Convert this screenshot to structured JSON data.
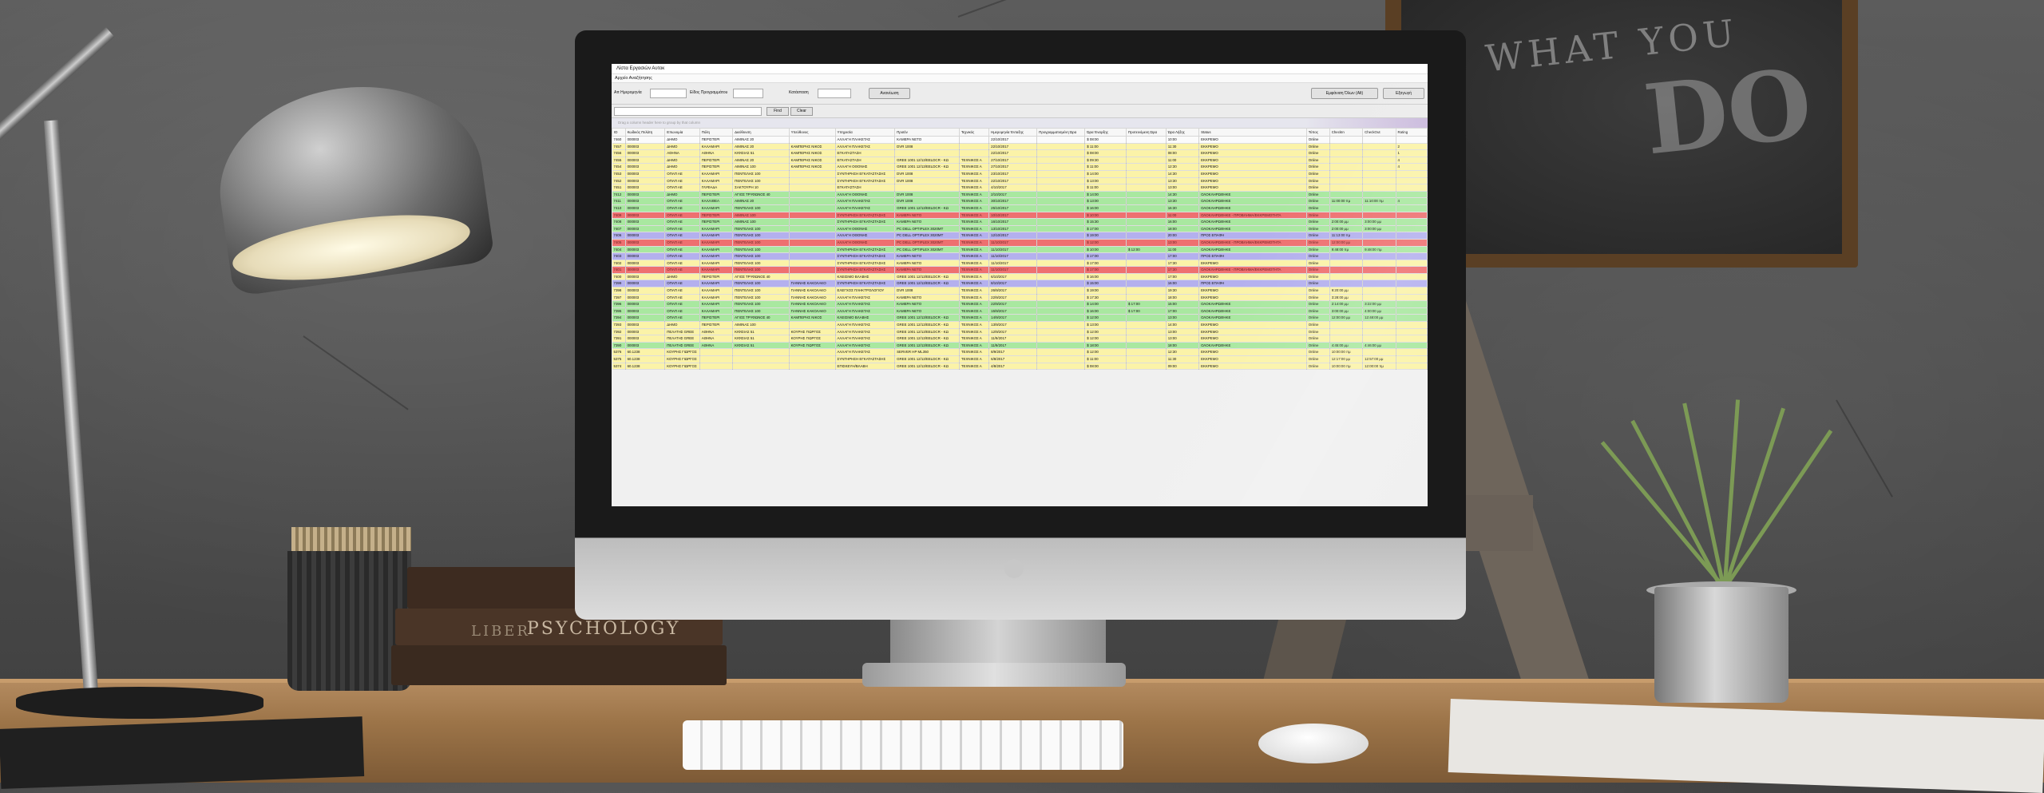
{
  "scene": {
    "chalkboard_text_top": "WHAT YOU",
    "chalkboard_text_big": "DO",
    "book_title_1": "LIBER",
    "book_title_2": "PSYCHOLOGY"
  },
  "app": {
    "window_title": "Λίστα Εργασιών Αυτοκ",
    "menu": "Αρχείο Αναζήτησης",
    "filters": {
      "date_label": "Απ Ημερομηνία",
      "date_value": "",
      "type_label": "Είδος Προγραμμάτου",
      "type_value": "",
      "status_label": "Κατάσταση",
      "status_value": "",
      "refresh_button": "Ανανέωση",
      "new_order_button": "Εμφάνιση Όλων (Alt)",
      "export_button": "Εξαγωγή"
    },
    "search": {
      "placeholder": "",
      "find_button": "Find",
      "clear_button": "Clear"
    },
    "group_hint": "Drag a column header here to group by that column",
    "columns": [
      "ID",
      "Κωδικός Πελάτη",
      "Επωνυμία",
      "Πόλη",
      "Διεύθυνση",
      "Υπεύθυνος",
      "Υπηρεσία",
      "Προϊόν",
      "Τεχνικός",
      "Ημερομηνία Ένταξης",
      "Προγραμματισμένη Ώρα",
      "Ώρα Έναρξης",
      "Προτεινόμενη Ώρα",
      "Ώρα Λήξης",
      "Status",
      "Τύπος",
      "CheckIn",
      "CheckOut",
      "Rating"
    ],
    "rows": [
      {
        "color": "white",
        "cells": [
          "7460",
          "000003",
          "ΔΗΜΟ",
          "ΠΕΡΙΣΤΕΡΙ",
          "ΑΙΜΙΝΑΣ 20",
          "",
          "ΑΛΛΑΓΗ ΠΛΑΚΕΤΑΣ",
          "ΚΑΜΕΡΑ ΝΕΤΟ",
          "",
          "22/10/2017",
          "",
          "$ 08:00",
          "",
          "10:00",
          "ΕΚΚΡΕΜΟ",
          "Online",
          "",
          "",
          ""
        ]
      },
      {
        "color": "yellow",
        "cells": [
          "7457",
          "000003",
          "ΔΗΜΟ",
          "ΚΑΛΑΜΑΡΙ",
          "ΑΙΜΙΝΑΣ 20",
          "ΚΑΜΠΕΡΗΣ ΝΙΚΟΣ",
          "ΑΛΛΑΓΗ ΠΛΑΚΕΤΑΣ",
          "DVR 1008",
          "",
          "22/10/2017",
          "",
          "$ 11:00",
          "",
          "11:30",
          "ΕΚΚΡΕΜΟ",
          "Online",
          "",
          "",
          "2"
        ]
      },
      {
        "color": "yellow",
        "cells": [
          "7456",
          "000003",
          "ΑΘΗΝΑ",
          "ΑΘΗΝΑ",
          "ΚΙΦΙΣΙΑΣ 51",
          "ΚΑΜΠΕΡΗΣ ΝΙΚΟΣ",
          "ΕΓΚΑΤΑΣΤΑΣΗ",
          "",
          "",
          "22/10/2017",
          "",
          "$ 08:00",
          "",
          "08:00",
          "ΕΚΚΡΕΜΟ",
          "Online",
          "",
          "",
          "1"
        ]
      },
      {
        "color": "yellow",
        "cells": [
          "7455",
          "000003",
          "ΔΗΜΟ",
          "ΠΕΡΙΣΤΕΡΙ",
          "ΑΙΜΙΝΑΣ 20",
          "ΚΑΜΠΕΡΗΣ ΝΙΚΟΣ",
          "ΕΓΚΑΤΑΣΤΑΣΗ",
          "GREE 1001 12/13/EELDCR - KΩ",
          "ΤΕΧΝΙΚΟΣ Α",
          "27/10/2017",
          "",
          "$ 09:30",
          "",
          "11:00",
          "ΕΚΚΡΕΜΟ",
          "Online",
          "",
          "",
          "4"
        ]
      },
      {
        "color": "yellow",
        "cells": [
          "7454",
          "000003",
          "ΔΗΜΟ",
          "ΠΕΡΙΣΤΕΡΙ",
          "ΑΙΜΙΝΑΣ 100",
          "ΚΑΜΠΕΡΗΣ ΝΙΚΟΣ",
          "ΑΛΛΑΓΗ ΟΘΟΝΗΣ",
          "GREE 1001 12/13/EELDCR - KΩ",
          "ΤΕΧΝΙΚΟΣ Α",
          "27/10/2017",
          "",
          "$ 11:00",
          "",
          "12:30",
          "ΕΚΚΡΕΜΟ",
          "Online",
          "",
          "",
          "4"
        ]
      },
      {
        "color": "yellow",
        "cells": [
          "7453",
          "000003",
          "ΟΠΑΠ ΑΕ",
          "ΚΑΛΑΜΑΡΙ",
          "ΠΕΝΤΕΛΗΣ 100",
          "",
          "ΣΥΝΤΗΡΗΣΗ ΕΓΚΑΤΑΣΤΑΣΗΣ",
          "DVR 1008",
          "ΤΕΧΝΙΚΟΣ Α",
          "23/10/2017",
          "",
          "$ 14:00",
          "",
          "14:30",
          "ΕΚΚΡΕΜΟ",
          "Online",
          "",
          "",
          ""
        ]
      },
      {
        "color": "yellow",
        "cells": [
          "7452",
          "000003",
          "ΟΠΑΠ ΑΕ",
          "ΚΑΛΑΜΑΡΙ",
          "ΠΕΝΤΕΛΗΣ 100",
          "",
          "ΣΥΝΤΗΡΗΣΗ ΕΓΚΑΤΑΣΤΑΣΗΣ",
          "DVR 1008",
          "ΤΕΧΝΙΚΟΣ Α",
          "22/10/2017",
          "",
          "$ 13:00",
          "",
          "13:30",
          "ΕΚΚΡΕΜΟ",
          "Online",
          "",
          "",
          ""
        ]
      },
      {
        "color": "yellow",
        "cells": [
          "7451",
          "000003",
          "ΟΠΑΠ ΑΕ",
          "ΓΛΥΦΑΔΑ",
          "ΣΑΚΤΟΥΡΗ 10",
          "",
          "ΕΓΚΑΤΑΣΤΑΣΗ",
          "",
          "ΤΕΧΝΙΚΟΣ Α",
          "4/10/2017",
          "",
          "$ 11:00",
          "",
          "13:00",
          "ΕΚΚΡΕΜΟ",
          "Online",
          "",
          "",
          ""
        ]
      },
      {
        "color": "green",
        "cells": [
          "7412",
          "000003",
          "ΔΗΜΟ",
          "ΠΕΡΙΣΤΕΡΙ",
          "ΑΓΙΟΣ ΤΡΥΦΩΝΟΣ 40",
          "",
          "ΑΛΛΑΓΗ ΟΘΟΝΗΣ",
          "DVR 1008",
          "ΤΕΧΝΙΚΟΣ Α",
          "2/10/2017",
          "",
          "$ 14:00",
          "",
          "14:30",
          "ΟΛΟΚΛΗΡΩΘΗΚΕ",
          "Online",
          "",
          "",
          ""
        ]
      },
      {
        "color": "green",
        "cells": [
          "7411",
          "000003",
          "ΟΠΑΠ ΑΕ",
          "ΚΑΛΛΙΘΕΑ",
          "ΑΙΜΙΝΑΣ 20",
          "",
          "ΑΛΛΑΓΗ ΠΛΑΚΕΤΑΣ",
          "DVR 1008",
          "ΤΕΧΝΙΚΟΣ Α",
          "30/10/2017",
          "",
          "$ 13:00",
          "",
          "13:30",
          "ΟΛΟΚΛΗΡΩΘΗΚΕ",
          "Online",
          "11:00:00 πμ",
          "11:10:00 πμ",
          "4"
        ]
      },
      {
        "color": "green",
        "cells": [
          "7410",
          "000003",
          "ΟΠΑΠ ΑΕ",
          "ΚΑΛΑΜΑΡΙ",
          "ΠΕΝΤΕΛΗΣ 100",
          "",
          "ΑΛΛΑΓΗ ΠΛΑΚΕΤΑΣ",
          "GREE 1001 12/13/EELDCR - KΩ",
          "ΤΕΧΝΙΚΟΣ Α",
          "25/10/2017",
          "",
          "$ 16:00",
          "",
          "16:30",
          "ΟΛΟΚΛΗΡΩΘΗΚΕ",
          "Online",
          "",
          "",
          ""
        ]
      },
      {
        "color": "red",
        "cells": [
          "7409",
          "000003",
          "ΟΠΑΠ ΑΕ",
          "ΠΕΡΙΣΤΕΡΙ",
          "ΑΙΜΙΝΑΣ 100",
          "",
          "ΣΥΝΤΗΡΗΣΗ ΕΓΚΑΤΑΣΤΑΣΗΣ",
          "ΚΑΜΕΡΑ ΝΕΤΟ",
          "ΤΕΧΝΙΚΟΣ Α",
          "10/10/2017",
          "",
          "$ 10:00",
          "",
          "11:00",
          "ΟΛΟΚΛΗΡΩΘΗΚΕ - ΠΡΟΒΛΗΜΑ/ΕΚΚΡΕΜΟΤΗΤΑ",
          "Online",
          "",
          "",
          ""
        ]
      },
      {
        "color": "green",
        "cells": [
          "7408",
          "000003",
          "ΟΠΑΠ ΑΕ",
          "ΠΕΡΙΣΤΕΡΙ",
          "ΑΙΜΙΝΑΣ 100",
          "",
          "ΣΥΝΤΗΡΗΣΗ ΕΓΚΑΤΑΣΤΑΣΗΣ",
          "ΚΑΜΕΡΑ ΝΕΤΟ",
          "ΤΕΧΝΙΚΟΣ Α",
          "16/10/2017",
          "",
          "$ 15:30",
          "",
          "16:00",
          "ΟΛΟΚΛΗΡΩΘΗΚΕ",
          "Online",
          "2:00:00 μμ",
          "3:00:00 μμ",
          ""
        ]
      },
      {
        "color": "green",
        "cells": [
          "7407",
          "000003",
          "ΟΠΑΠ ΑΕ",
          "ΚΑΛΑΜΑΡΙ",
          "ΠΕΝΤΕΛΗΣ 100",
          "",
          "ΑΛΛΑΓΗ ΟΘΟΝΗΣ",
          "PC DELL OPTIPLEX 3020MT",
          "ΤΕΧΝΙΚΟΣ Α",
          "13/10/2017",
          "",
          "$ 17:00",
          "",
          "18:00",
          "ΟΛΟΚΛΗΡΩΘΗΚΕ",
          "Online",
          "2:00:00 μμ",
          "3:00:00 μμ",
          ""
        ]
      },
      {
        "color": "purple",
        "cells": [
          "7406",
          "000003",
          "ΟΠΑΠ ΑΕ",
          "ΚΑΛΑΜΑΡΙ",
          "ΠΕΝΤΕΛΗΣ 100",
          "",
          "ΑΛΛΑΓΗ ΟΘΟΝΗΣ",
          "PC DELL OPTIPLEX 3020MT",
          "ΤΕΧΝΙΚΟΣ Α",
          "12/10/2017",
          "",
          "$ 19:00",
          "",
          "20:00",
          "ΠΡΟΣ ΕΠΑΦΗ",
          "Online",
          "11:13:00 πμ",
          "",
          ""
        ]
      },
      {
        "color": "red",
        "cells": [
          "7405",
          "000003",
          "ΟΠΑΠ ΑΕ",
          "ΚΑΛΑΜΑΡΙ",
          "ΠΕΝΤΕΛΗΣ 100",
          "",
          "ΑΛΛΑΓΗ ΟΘΟΝΗΣ",
          "PC DELL OPTIPLEX 3020MT",
          "ΤΕΧΝΙΚΟΣ Α",
          "11/10/2017",
          "",
          "$ 12:00",
          "",
          "13:00",
          "ΟΛΟΚΛΗΡΩΘΗΚΕ - ΠΡΟΒΛΗΜΑ/ΕΚΚΡΕΜΟΤΗΤΑ",
          "Online",
          "12:00:00 μμ",
          "",
          ""
        ]
      },
      {
        "color": "green",
        "cells": [
          "7404",
          "000003",
          "ΟΠΑΠ ΑΕ",
          "ΚΑΛΑΜΑΡΙ",
          "ΠΕΝΤΕΛΗΣ 100",
          "",
          "ΣΥΝΤΗΡΗΣΗ ΕΓΚΑΤΑΣΤΑΣΗΣ",
          "PC DELL OPTIPLEX 3020MT",
          "ΤΕΧΝΙΚΟΣ Α",
          "11/10/2017",
          "",
          "$ 10:00",
          "$ 12:00",
          "11:00",
          "ΟΛΟΚΛΗΡΩΘΗΚΕ",
          "Online",
          "9:48:00 πμ",
          "9:48:00 πμ",
          ""
        ]
      },
      {
        "color": "purple",
        "cells": [
          "7403",
          "000003",
          "ΟΠΑΠ ΑΕ",
          "ΚΑΛΑΜΑΡΙ",
          "ΠΕΝΤΕΛΗΣ 100",
          "",
          "ΣΥΝΤΗΡΗΣΗ ΕΓΚΑΤΑΣΤΑΣΗΣ",
          "ΚΑΜΕΡΑ ΝΕΤΟ",
          "ΤΕΧΝΙΚΟΣ Α",
          "11/10/2017",
          "",
          "$ 17:00",
          "",
          "17:00",
          "ΠΡΟΣ ΕΠΑΦΗ",
          "Online",
          "",
          "",
          ""
        ]
      },
      {
        "color": "yellow",
        "cells": [
          "7402",
          "000003",
          "ΟΠΑΠ ΑΕ",
          "ΚΑΛΑΜΑΡΙ",
          "ΠΕΝΤΕΛΗΣ 100",
          "",
          "ΣΥΝΤΗΡΗΣΗ ΕΓΚΑΤΑΣΤΑΣΗΣ",
          "ΚΑΜΕΡΑ ΝΕΤΟ",
          "ΤΕΧΝΙΚΟΣ Α",
          "11/10/2017",
          "",
          "$ 17:00",
          "",
          "17:30",
          "ΕΚΚΡΕΜΟ",
          "Online",
          "",
          "",
          ""
        ]
      },
      {
        "color": "red",
        "cells": [
          "7401",
          "000003",
          "ΟΠΑΠ ΑΕ",
          "ΚΑΛΑΜΑΡΙ",
          "ΠΕΝΤΕΛΗΣ 100",
          "",
          "ΣΥΝΤΗΡΗΣΗ ΕΓΚΑΤΑΣΤΑΣΗΣ",
          "ΚΑΜΕΡΑ ΝΕΤΟ",
          "ΤΕΧΝΙΚΟΣ Α",
          "11/10/2017",
          "",
          "$ 17:00",
          "",
          "17:30",
          "ΟΛΟΚΛΗΡΩΘΗΚΕ - ΠΡΟΒΛΗΜΑ/ΕΚΚΡΕΜΟΤΗΤΑ",
          "Online",
          "",
          "",
          ""
        ]
      },
      {
        "color": "yellow",
        "cells": [
          "7400",
          "000003",
          "ΔΗΜΟ",
          "ΠΕΡΙΣΤΕΡΙ",
          "ΑΓΙΟΣ ΤΡΥΦΩΝΟΣ 40",
          "",
          "ΚΛΕΙΣΙΜΟ ΒΛΑΒΗΣ",
          "GREE 1001 12/13/EELDCR - KΩ",
          "ΤΕΧΝΙΚΟΣ Α",
          "6/10/2017",
          "",
          "$ 16:00",
          "",
          "17:00",
          "ΕΚΚΡΕΜΟ",
          "Online",
          "",
          "",
          ""
        ]
      },
      {
        "color": "purple",
        "cells": [
          "7399",
          "000003",
          "ΟΠΑΠ ΑΕ",
          "ΚΑΛΑΜΑΡΙ",
          "ΠΕΝΤΕΛΗΣ 100",
          "ΓΙΑΝΝΗΣ ΚΑΚΟΛΑΚΟ",
          "ΣΥΝΤΗΡΗΣΗ ΕΓΚΑΤΑΣΤΑΣΗΣ",
          "GREE 1001 12/13/EELDCR - KΩ",
          "ΤΕΧΝΙΚΟΣ Α",
          "8/10/2017",
          "",
          "$ 15:00",
          "",
          "16:00",
          "ΠΡΟΣ ΕΠΑΦΗ",
          "Online",
          "",
          "",
          ""
        ]
      },
      {
        "color": "yellow",
        "cells": [
          "7398",
          "000003",
          "ΟΠΑΠ ΑΕ",
          "ΚΑΛΑΜΑΡΙ",
          "ΠΕΝΤΕΛΗΣ 100",
          "ΓΙΑΝΝΗΣ ΚΑΚΟΛΑΚΟ",
          "ΕΛΕΓΧΟΣ ΠΛΗΚΤΡΟΛΟΓΙΟΥ",
          "DVR 1008",
          "ΤΕΧΝΙΚΟΣ Α",
          "26/9/2017",
          "",
          "$ 19:00",
          "",
          "19:30",
          "ΕΚΚΡΕΜΟ",
          "Online",
          "9:20:00 μμ",
          "",
          ""
        ]
      },
      {
        "color": "yellow",
        "cells": [
          "7397",
          "000003",
          "ΟΠΑΠ ΑΕ",
          "ΚΑΛΑΜΑΡΙ",
          "ΠΕΝΤΕΛΗΣ 100",
          "ΓΙΑΝΝΗΣ ΚΑΚΟΛΑΚΟ",
          "ΑΛΛΑΓΗ ΠΛΑΚΕΤΑΣ",
          "ΚΑΜΕΡΑ ΝΕΤΟ",
          "ΤΕΧΝΙΚΟΣ Α",
          "22/9/2017",
          "",
          "$ 17:30",
          "",
          "18:00",
          "ΕΚΚΡΕΜΟ",
          "Online",
          "3:28:00 μμ",
          "",
          ""
        ]
      },
      {
        "color": "green",
        "cells": [
          "7396",
          "000003",
          "ΟΠΑΠ ΑΕ",
          "ΚΑΛΑΜΑΡΙ",
          "ΠΕΝΤΕΛΗΣ 100",
          "ΓΙΑΝΝΗΣ ΚΑΚΟΛΑΚΟ",
          "ΑΛΛΑΓΗ ΠΛΑΚΕΤΑΣ",
          "ΚΑΜΕΡΑ ΝΕΤΟ",
          "ΤΕΧΝΙΚΟΣ Α",
          "22/9/2017",
          "",
          "$ 14:00",
          "$ 17:00",
          "15:00",
          "ΟΛΟΚΛΗΡΩΘΗΚΕ",
          "Online",
          "2:14:00 μμ",
          "3:22:00 μμ",
          ""
        ]
      },
      {
        "color": "green",
        "cells": [
          "7395",
          "000003",
          "ΟΠΑΠ ΑΕ",
          "ΚΑΛΑΜΑΡΙ",
          "ΠΕΝΤΕΛΗΣ 100",
          "ΓΙΑΝΝΗΣ ΚΑΚΟΛΑΚΟ",
          "ΑΛΛΑΓΗ ΠΛΑΚΕΤΑΣ",
          "ΚΑΜΕΡΑ ΝΕΤΟ",
          "ΤΕΧΝΙΚΟΣ Α",
          "15/9/2017",
          "",
          "$ 16:00",
          "$ 17:00",
          "17:00",
          "ΟΛΟΚΛΗΡΩΘΗΚΕ",
          "Online",
          "3:00:00 μμ",
          "4:00:00 μμ",
          ""
        ]
      },
      {
        "color": "green",
        "cells": [
          "7394",
          "000003",
          "ΟΠΑΠ ΑΕ",
          "ΠΕΡΙΣΤΕΡΙ",
          "ΑΓΙΟΣ ΤΡΥΦΩΝΟΣ 40",
          "ΚΑΜΠΕΡΗΣ ΝΙΚΟΣ",
          "ΚΛΕΙΣΙΜΟ ΒΛΑΒΗΣ",
          "GREE 1001 12/13/EELDCR - KΩ",
          "ΤΕΧΝΙΚΟΣ Α",
          "14/9/2017",
          "",
          "$ 12:00",
          "",
          "13:00",
          "ΟΛΟΚΛΗΡΩΘΗΚΕ",
          "Online",
          "12:00:00 μμ",
          "12:48:00 μμ",
          ""
        ]
      },
      {
        "color": "yellow",
        "cells": [
          "7393",
          "000003",
          "ΔΗΜΟ",
          "ΠΕΡΙΣΤΕΡΙ",
          "ΑΙΜΙΝΑΣ 100",
          "",
          "ΑΛΛΑΓΗ ΠΛΑΚΕΤΑΣ",
          "GREE 1001 12/13/EELDCR - KΩ",
          "ΤΕΧΝΙΚΟΣ Α",
          "13/9/2017",
          "",
          "$ 13:00",
          "",
          "14:00",
          "ΕΚΚΡΕΜΟ",
          "Online",
          "",
          "",
          ""
        ]
      },
      {
        "color": "yellow",
        "cells": [
          "7392",
          "000003",
          "ΠΕΛΑΤΗΣ GREE",
          "ΑΘΗΝΑ",
          "ΚΙΦΙΣΙΑΣ 51",
          "ΚΟΥΡΗΣ ΓΙΩΡΓΟΣ",
          "ΑΛΛΑΓΗ ΠΛΑΚΕΤΑΣ",
          "GREE 1001 12/13/EELDCR - KΩ",
          "ΤΕΧΝΙΚΟΣ Α",
          "12/9/2017",
          "",
          "$ 12:00",
          "",
          "13:00",
          "ΕΚΚΡΕΜΟ",
          "Online",
          "",
          "",
          ""
        ]
      },
      {
        "color": "yellow",
        "cells": [
          "7391",
          "000003",
          "ΠΕΛΑΤΗΣ GREE",
          "ΑΘΗΝΑ",
          "ΚΙΦΙΣΙΑΣ 51",
          "ΚΟΥΡΗΣ ΓΙΩΡΓΟΣ",
          "ΑΛΛΑΓΗ ΠΛΑΚΕΤΑΣ",
          "GREE 1001 12/13/EELDCR - KΩ",
          "ΤΕΧΝΙΚΟΣ Α",
          "11/9/2017",
          "",
          "$ 12:00",
          "",
          "13:00",
          "ΕΚΚΡΕΜΟ",
          "Online",
          "",
          "",
          ""
        ]
      },
      {
        "color": "green",
        "cells": [
          "7390",
          "000003",
          "ΠΕΛΑΤΗΣ GREE",
          "ΑΘΗΝΑ",
          "ΚΙΦΙΣΙΑΣ 51",
          "ΚΟΥΡΗΣ ΓΙΩΡΓΟΣ",
          "ΑΛΛΑΓΗ ΠΛΑΚΕΤΑΣ",
          "GREE 1001 12/13/EELDCR - KΩ",
          "ΤΕΧΝΙΚΟΣ Α",
          "11/9/2017",
          "",
          "$ 18:00",
          "",
          "18:00",
          "ΟΛΟΚΛΗΡΩΘΗΚΕ",
          "Online",
          "4:45:00 μμ",
          "4:46:00 μμ",
          ""
        ]
      },
      {
        "color": "yellow",
        "cells": [
          "5376",
          "60.1238",
          "ΚΟΥΡΗΣ ΓΙΩΡΓΟΣ",
          "",
          "",
          "",
          "ΑΛΛΑΓΗ ΠΛΑΚΕΤΑΣ",
          "SERVER HP ML350",
          "ΤΕΧΝΙΚΟΣ Α",
          "8/9/2017",
          "",
          "$ 12:00",
          "",
          "12:30",
          "ΕΚΚΡΕΜΟ",
          "Online",
          "10:00:00 πμ",
          "",
          ""
        ]
      },
      {
        "color": "yellow",
        "cells": [
          "5375",
          "60.1238",
          "ΚΟΥΡΗΣ ΓΙΩΡΓΟΣ",
          "",
          "",
          "",
          "ΣΥΝΤΗΡΗΣΗ ΕΓΚΑΤΑΣΤΑΣΗΣ",
          "GREE 1001 12/13/EELDCR - KΩ",
          "ΤΕΧΝΙΚΟΣ Α",
          "6/8/2017",
          "",
          "$ 11:00",
          "",
          "11:30",
          "ΕΚΚΡΕΜΟ",
          "Online",
          "12:17:00 μμ",
          "12:57:00 μμ",
          ""
        ]
      },
      {
        "color": "yellow",
        "cells": [
          "5374",
          "60.1238",
          "ΚΟΥΡΗΣ ΓΙΩΡΓΟΣ",
          "",
          "",
          "",
          "ΕΠΙΣΚΕΥΗ/ΒΛΑΒΗ",
          "GREE 1001 12/13/EELDCR - KΩ",
          "ΤΕΧΝΙΚΟΣ Α",
          "4/8/2017",
          "",
          "$ 08:00",
          "",
          "09:00",
          "ΕΚΚΡΕΜΟ",
          "Online",
          "10:00:00 πμ",
          "12:00:00 πμ",
          ""
        ]
      }
    ]
  }
}
